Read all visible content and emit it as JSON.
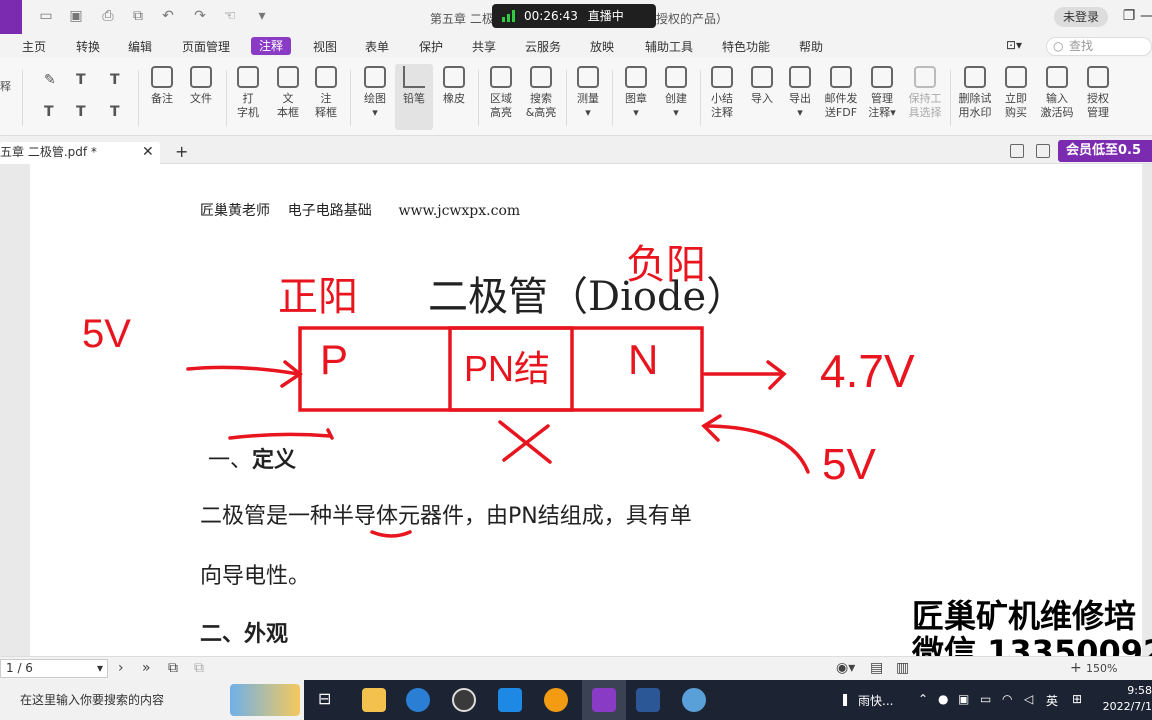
{
  "titlebar": {
    "doc_title": "第五章 二极",
    "doc_title_tail": "授权的产品）",
    "live_timer": "00:26:43",
    "live_status": "直播中",
    "login": "未登录"
  },
  "menu": {
    "items": [
      "主页",
      "转换",
      "编辑",
      "页面管理",
      "注释",
      "视图",
      "表单",
      "保护",
      "共享",
      "云服务",
      "放映",
      "辅助工具",
      "特色功能",
      "帮助"
    ],
    "search_placeholder": "查找"
  },
  "ribbon": {
    "left_cut": "释",
    "tools": [
      {
        "label": "备注",
        "sub": ""
      },
      {
        "label": "文件",
        "sub": ""
      },
      {
        "label": "打",
        "sub": "字机"
      },
      {
        "label": "文",
        "sub": "本框"
      },
      {
        "label": "注",
        "sub": "释框"
      },
      {
        "label": "绘图",
        "sub": ""
      },
      {
        "label": "铅笔",
        "sub": ""
      },
      {
        "label": "橡皮",
        "sub": ""
      },
      {
        "label": "区域",
        "sub": "高亮"
      },
      {
        "label": "搜索",
        "sub": "&高亮"
      },
      {
        "label": "测量",
        "sub": ""
      },
      {
        "label": "图章",
        "sub": ""
      },
      {
        "label": "创建",
        "sub": ""
      },
      {
        "label": "小结",
        "sub": "注释"
      },
      {
        "label": "导入",
        "sub": ""
      },
      {
        "label": "导出",
        "sub": ""
      },
      {
        "label": "邮件发",
        "sub": "送FDF"
      },
      {
        "label": "管理",
        "sub": "注释"
      },
      {
        "label": "保持工",
        "sub": "具选择"
      },
      {
        "label": "删除试",
        "sub": "用水印"
      },
      {
        "label": "立即",
        "sub": "购买"
      },
      {
        "label": "输入",
        "sub": "激活码"
      },
      {
        "label": "授权",
        "sub": "管理"
      }
    ]
  },
  "tabs": {
    "doc_tab": "五章 二极管.pdf *",
    "vip": "会员低至0.5"
  },
  "pdf": {
    "header": "匠巢黄老师    电子电路基础      www.jcwxpx.com",
    "title": "二极管（Diode）",
    "h1_num": "一、",
    "h1": "定义",
    "para1": "二极管是一种半导体元器件，由PN结组成，具有单",
    "para2": "向导电性。",
    "h2": "二、外观"
  },
  "ink": {
    "positive": "正阳",
    "negative": "负阳",
    "v_left": "5V",
    "p": "P",
    "pn": "PN结",
    "n": "N",
    "v_right": "4.7V",
    "v_bottom": "5V"
  },
  "watermark": {
    "line1": "匠巢矿机维修培",
    "line2": "微信 13350092"
  },
  "status": {
    "page": "1 / 6",
    "zoom": "150%"
  },
  "taskbar": {
    "search_placeholder": "在这里输入你要搜索的内容",
    "weather": "雨快...",
    "lang": "英",
    "time": "9:58",
    "date": "2022/7/1"
  },
  "colors": {
    "accent": "#8a3bc6",
    "ink": "#e8141e"
  }
}
